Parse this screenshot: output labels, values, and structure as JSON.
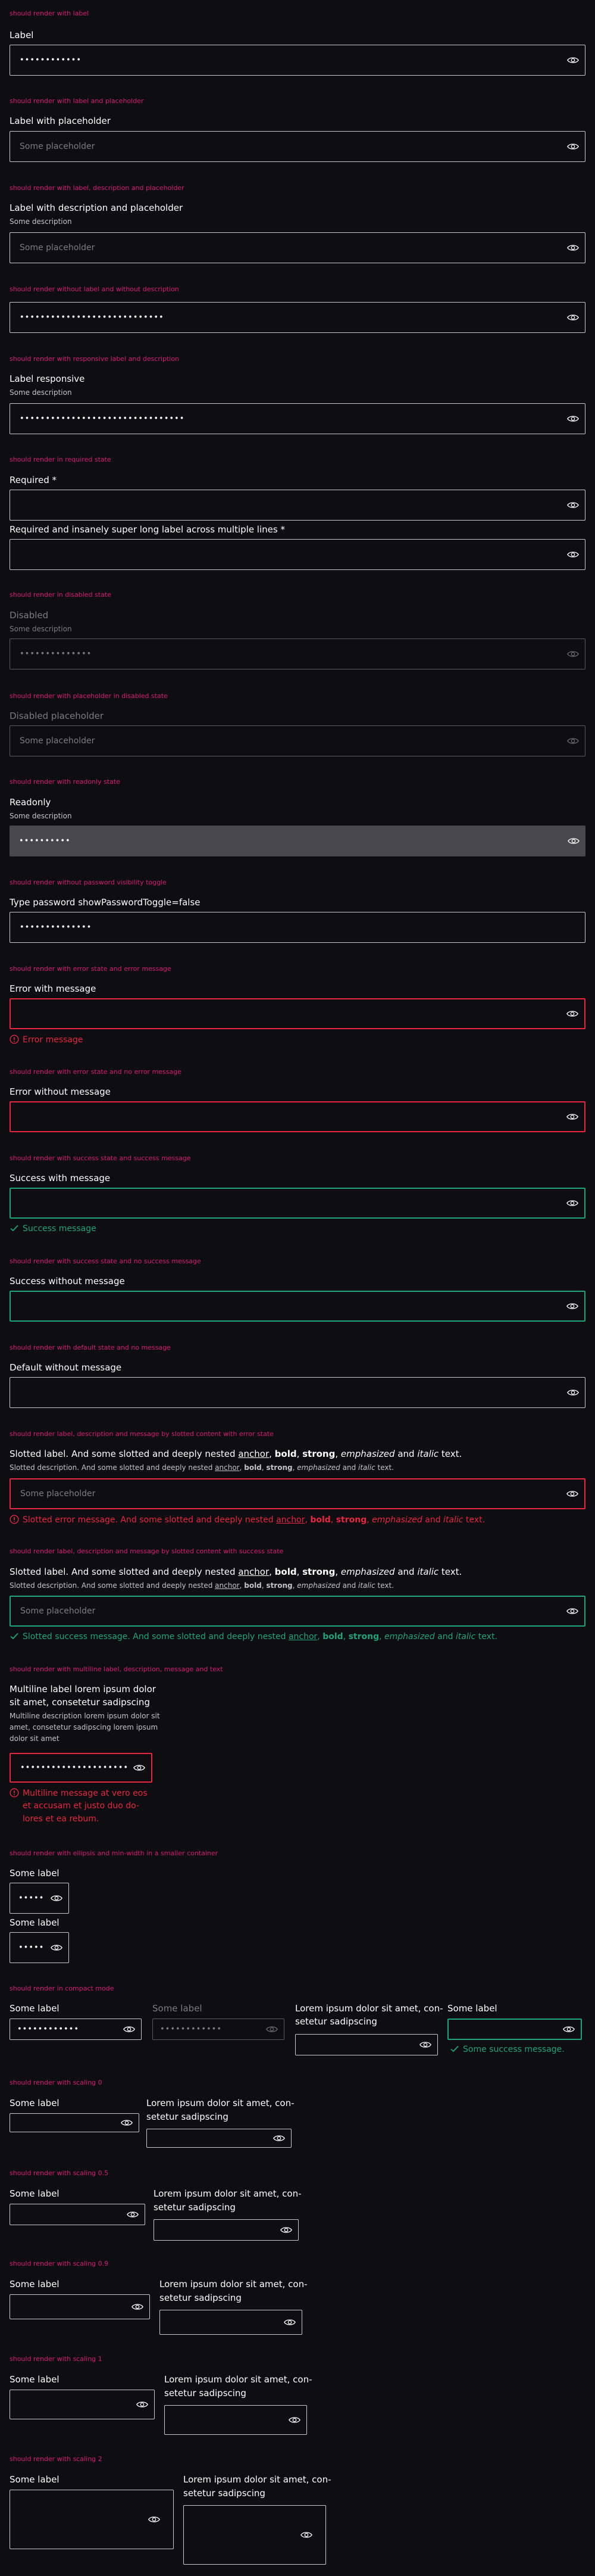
{
  "sections": {
    "s1": {
      "title": "should render with label",
      "label": "Label",
      "value": "••••••••••••"
    },
    "s2": {
      "title": "should render with label and placeholder",
      "label": "Label with placeholder",
      "placeholder": "Some placeholder"
    },
    "s3": {
      "title": "should render with label, description and placeholder",
      "label": "Label with description and placeholder",
      "description": "Some description",
      "placeholder": "Some placeholder"
    },
    "s4": {
      "title": "should render without label and without description",
      "value": "••••••••••••••••••••••••••••"
    },
    "s5": {
      "title": "should render with responsive label and description",
      "label": "Label responsive",
      "description": "Some description",
      "value": "••••••••••••••••••••••••••••••••"
    },
    "s6": {
      "title": "should render in required state",
      "label1": "Required *",
      "label2": "Required and insanely super long label across multiple lines *"
    },
    "s7": {
      "title": "should render in disabled state",
      "label": "Disabled",
      "description": "Some description",
      "value": "••••••••••••••"
    },
    "s8": {
      "title": "should render with placeholder in disabled state",
      "label": "Disabled placeholder",
      "placeholder": "Some placeholder"
    },
    "s9": {
      "title": "should render with readonly state",
      "label": "Readonly",
      "description": "Some description",
      "value": "••••••••••"
    },
    "s10": {
      "title": "should render without password visibility toggle",
      "label": "Type password showPasswordToggle=false",
      "value": "••••••••••••••"
    },
    "s11": {
      "title": "should render with error state and error message",
      "label": "Error with message",
      "message": "Error message"
    },
    "s12": {
      "title": "should render with error state and no error message",
      "label": "Error without message"
    },
    "s13": {
      "title": "should render with success state and success message",
      "label": "Success with message",
      "message": "Success message"
    },
    "s14": {
      "title": "should render with success state and no success message",
      "label": "Success without message"
    },
    "s15": {
      "title": "should render with default state and no message",
      "label": "Default without message"
    },
    "s16": {
      "title": "should render label, description and message by slotted content with error state",
      "label_a": "Slotted label. And some slotted and deeply nested ",
      "anchor": "anchor",
      "bold": "bold",
      "strong": "strong",
      "em": "emphasized",
      "and": " and ",
      "italic": "italic",
      "text": " text.",
      "comma": ", ",
      "desc_a": "Slotted description. And some slotted and deeply nested ",
      "msg_a": "Slotted error message. And some slotted and deeply nested ",
      "placeholder": "Some placeholder"
    },
    "s17": {
      "title": "should render label, description and message by slotted content with success state",
      "label_a": "Slotted label. And some slotted and deeply nested ",
      "desc_a": "Slotted description. And some slotted and deeply nested ",
      "msg_a": "Slotted success message. And some slotted and deeply nested ",
      "placeholder": "Some placeholder"
    },
    "s18": {
      "title": "should render with multiline label, description, message and text",
      "label_lines": [
        "Multiline label lorem ipsum dolor",
        "sit amet, consetetur sadipscing"
      ],
      "desc_lines": [
        "Multiline description lorem ipsum dolor sit",
        "amet, consetetur sadipscing lorem ipsum",
        "dolor sit amet"
      ],
      "value": "•••••••••••••••••••••••••••••••",
      "msg_lines": [
        "Multiline message at vero eos",
        "et accusam et justo duo do-",
        "lores et ea rebum."
      ]
    },
    "s19": {
      "title": "should render with ellipsis and min-width in a smaller container",
      "label1": "Some label",
      "label2": "Some label",
      "value": "•••••"
    },
    "s20": {
      "title": "should render in compact mode",
      "label1": "Some label",
      "label2": "Some label",
      "label3_lines": [
        "Lorem ipsum dolor sit amet, con-",
        "setetur sadipscing"
      ],
      "label4": "Some label",
      "value1": "••••••••••••",
      "value2": "••••••••••••",
      "message": "Some success message."
    },
    "s21": {
      "title": "should render with scaling 0",
      "label1": "Some label",
      "label2_lines": [
        "Lorem ipsum dolor sit amet, con-",
        "setetur sadipscing"
      ]
    },
    "s22": {
      "title": "should render with scaling 0.5",
      "label1": "Some label",
      "label2_lines": [
        "Lorem ipsum dolor sit amet, con-",
        "setetur sadipscing"
      ]
    },
    "s23": {
      "title": "should render with scaling 0.9",
      "label1": "Some label",
      "label2_lines": [
        "Lorem ipsum dolor sit amet, con-",
        "setetur sadipscing"
      ]
    },
    "s24": {
      "title": "should render with scaling 1",
      "label1": "Some label",
      "label2_lines": [
        "Lorem ipsum dolor sit amet, con-",
        "setetur sadipscing"
      ]
    },
    "s25": {
      "title": "should render with scaling 2",
      "label1": "Some label",
      "label2_lines": [
        "Lorem ipsum dolor sit amet, con-",
        "setetur sadipscing"
      ]
    }
  },
  "icons": {
    "toggle": "eye-icon",
    "error": "exclamation-circle-icon",
    "success": "check-icon"
  },
  "colors": {
    "background": "#0e0e12",
    "accent_title": "#d81b79",
    "error": "#e8263f",
    "success": "#1fa37a",
    "border": "#c9c9cc",
    "readonly_bg": "#48484c"
  }
}
